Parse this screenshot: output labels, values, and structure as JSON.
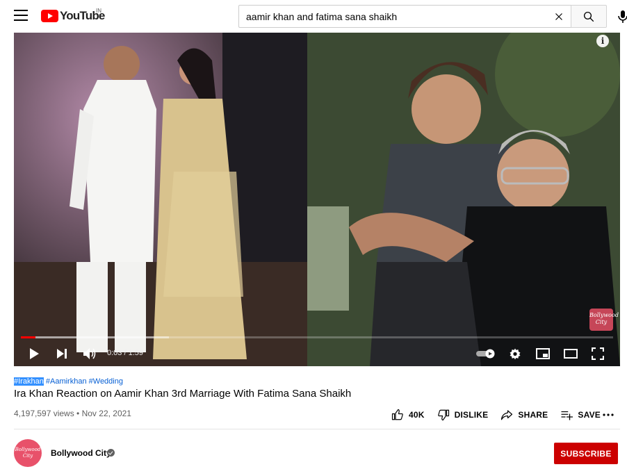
{
  "header": {
    "logo_text": "YouTube",
    "country_code": "IN",
    "search_value": "aamir khan and fatima sana shaikh"
  },
  "player": {
    "time_display": "0:03 / 1:59",
    "current_seconds": 3,
    "duration_seconds": 119,
    "buffered_fraction": 0.25,
    "info_label": "i",
    "watermark_text": "Bollywood City"
  },
  "video": {
    "hashtags": [
      "#Irakhan",
      "#Aamirkhan",
      "#Wedding"
    ],
    "title": "Ira Khan Reaction on Aamir Khan 3rd Marriage With Fatima Sana Shaikh",
    "meta": "4,197,597 views • Nov 22, 2021"
  },
  "actions": {
    "like": "40K",
    "dislike": "DISLIKE",
    "share": "SHARE",
    "save": "SAVE"
  },
  "channel": {
    "name": "Bollywood City",
    "avatar_text": "Bollywood City",
    "subscribe_label": "SUBSCRIBE"
  },
  "colors": {
    "brand_red": "#ff0000",
    "subscribe_red": "#cc0000",
    "link_blue": "#065fd4"
  }
}
